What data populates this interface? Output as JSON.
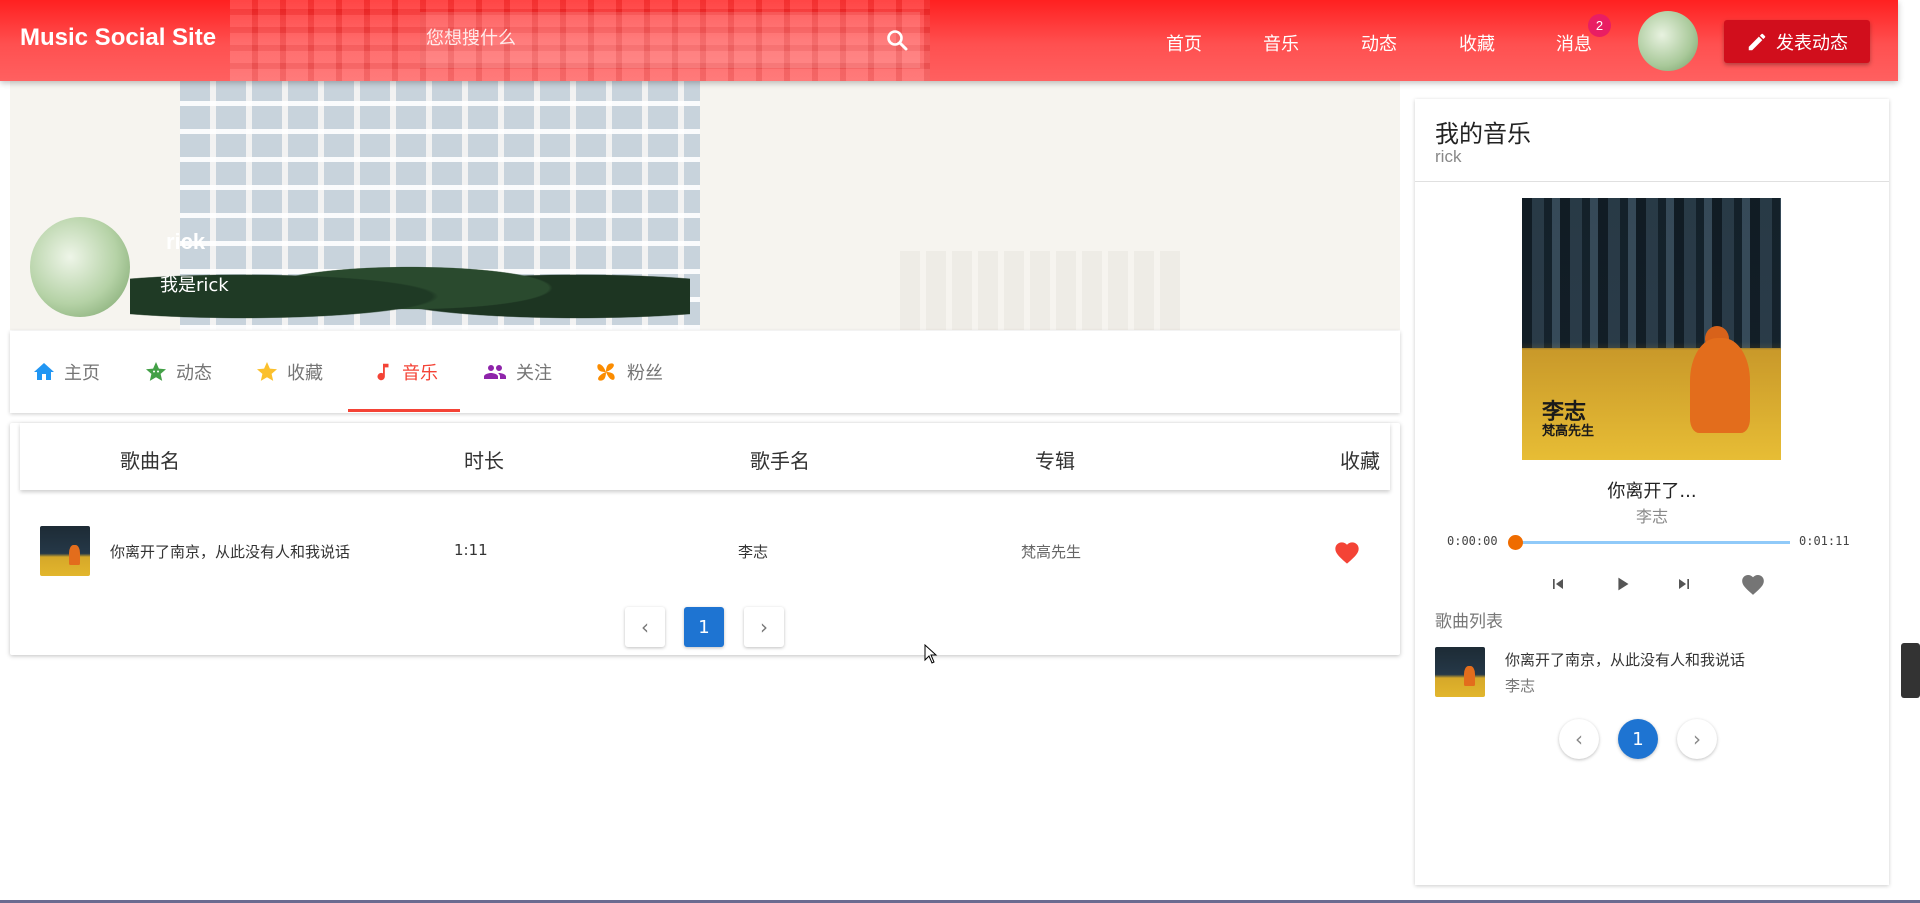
{
  "header": {
    "brand": "Music Social Site",
    "search_placeholder": "您想搜什么",
    "nav": [
      "首页",
      "音乐",
      "动态",
      "收藏",
      "消息"
    ],
    "message_badge": "2",
    "post_button": "发表动态"
  },
  "profile": {
    "name": "rick",
    "bio": "我是rick"
  },
  "tabs": [
    {
      "label": "主页",
      "icon": "home-icon",
      "color": "#2196f3"
    },
    {
      "label": "动态",
      "icon": "smiley-star-icon",
      "color": "#43a047"
    },
    {
      "label": "收藏",
      "icon": "star-icon",
      "color": "#fbc02d"
    },
    {
      "label": "音乐",
      "icon": "music-note-icon",
      "color": "#f44336"
    },
    {
      "label": "关注",
      "icon": "people-icon",
      "color": "#8e24aa"
    },
    {
      "label": "粉丝",
      "icon": "pinwheel-icon",
      "color": "#fb8c00"
    }
  ],
  "active_tab": "音乐",
  "songs_table": {
    "columns": [
      "歌曲名",
      "时长",
      "歌手名",
      "专辑",
      "收藏"
    ],
    "rows": [
      {
        "title": "你离开了南京，从此没有人和我说话",
        "duration": "1:11",
        "artist": "李志",
        "album": "梵高先生",
        "favorited": true
      }
    ],
    "pagination": {
      "prev": "‹",
      "current": "1",
      "next": "›"
    }
  },
  "player": {
    "title": "我的音乐",
    "subtitle": "rick",
    "album_art_text_main": "李志",
    "album_art_text_sub": "梵高先生",
    "now_playing_title": "你离开了...",
    "now_playing_artist": "李志",
    "time_current": "0:00:00",
    "time_total": "0:01:11",
    "progress": 0,
    "playlist_label": "歌曲列表",
    "playlist": [
      {
        "title": "你离开了南京，从此没有人和我说话",
        "artist": "李志"
      }
    ],
    "pagination": {
      "prev": "‹",
      "current": "1",
      "next": "›"
    }
  },
  "colors": {
    "header_red": "#ff2020",
    "post_button": "#d10e1c",
    "active_tab": "#f44336",
    "pager_active": "#1e74d2",
    "heart": "#f44336",
    "progress": "#ef6c00",
    "badge": "#e91e63"
  }
}
